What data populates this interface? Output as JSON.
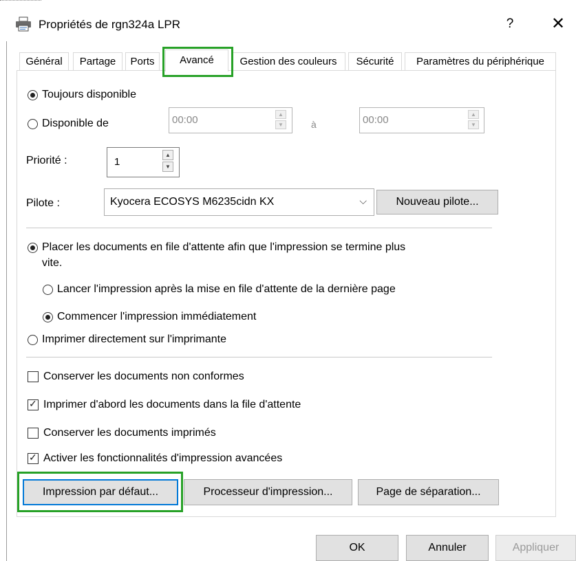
{
  "window": {
    "title": "Propriétés de rgn324a LPR",
    "help": "?",
    "close": "✕"
  },
  "tabs": [
    {
      "label": "Général"
    },
    {
      "label": "Partage"
    },
    {
      "label": "Ports"
    },
    {
      "label": "Avancé",
      "active": true
    },
    {
      "label": "Gestion des couleurs"
    },
    {
      "label": "Sécurité"
    },
    {
      "label": "Paramètres du périphérique"
    }
  ],
  "availability": {
    "always_label": "Toujours disponible",
    "always_selected": true,
    "from_label": "Disponible de",
    "from_value": "00:00",
    "to_label": "à",
    "to_value": "00:00"
  },
  "priority": {
    "label": "Priorité :",
    "value": "1"
  },
  "driver": {
    "label": "Pilote :",
    "value": "Kyocera ECOSYS M6235cidn KX",
    "new_button": "Nouveau pilote..."
  },
  "spooling": {
    "spool_label": "Placer les documents en file d'attente afin que l'impression se termine plus",
    "spool_label_line2": "vite.",
    "spool_selected": true,
    "after_last_page_label": "Lancer l'impression après la mise en file d'attente de la dernière page",
    "after_last_page_selected": false,
    "immediately_label": "Commencer l'impression immédiatement",
    "immediately_selected": true,
    "direct_label": "Imprimer directement sur l'imprimante",
    "direct_selected": false
  },
  "options": [
    {
      "label": "Conserver les documents non conformes",
      "checked": false
    },
    {
      "label": "Imprimer d'abord les documents dans la file d'attente",
      "checked": true
    },
    {
      "label": "Conserver les documents imprimés",
      "checked": false
    },
    {
      "label": "Activer les fonctionnalités d'impression avancées",
      "checked": true
    }
  ],
  "action_buttons": {
    "defaults": "Impression par défaut...",
    "processor": "Processeur d'impression...",
    "separator": "Page de séparation..."
  },
  "footer": {
    "ok": "OK",
    "cancel": "Annuler",
    "apply": "Appliquer"
  },
  "colors": {
    "highlight": "#27a127",
    "focus": "#0078d7"
  }
}
